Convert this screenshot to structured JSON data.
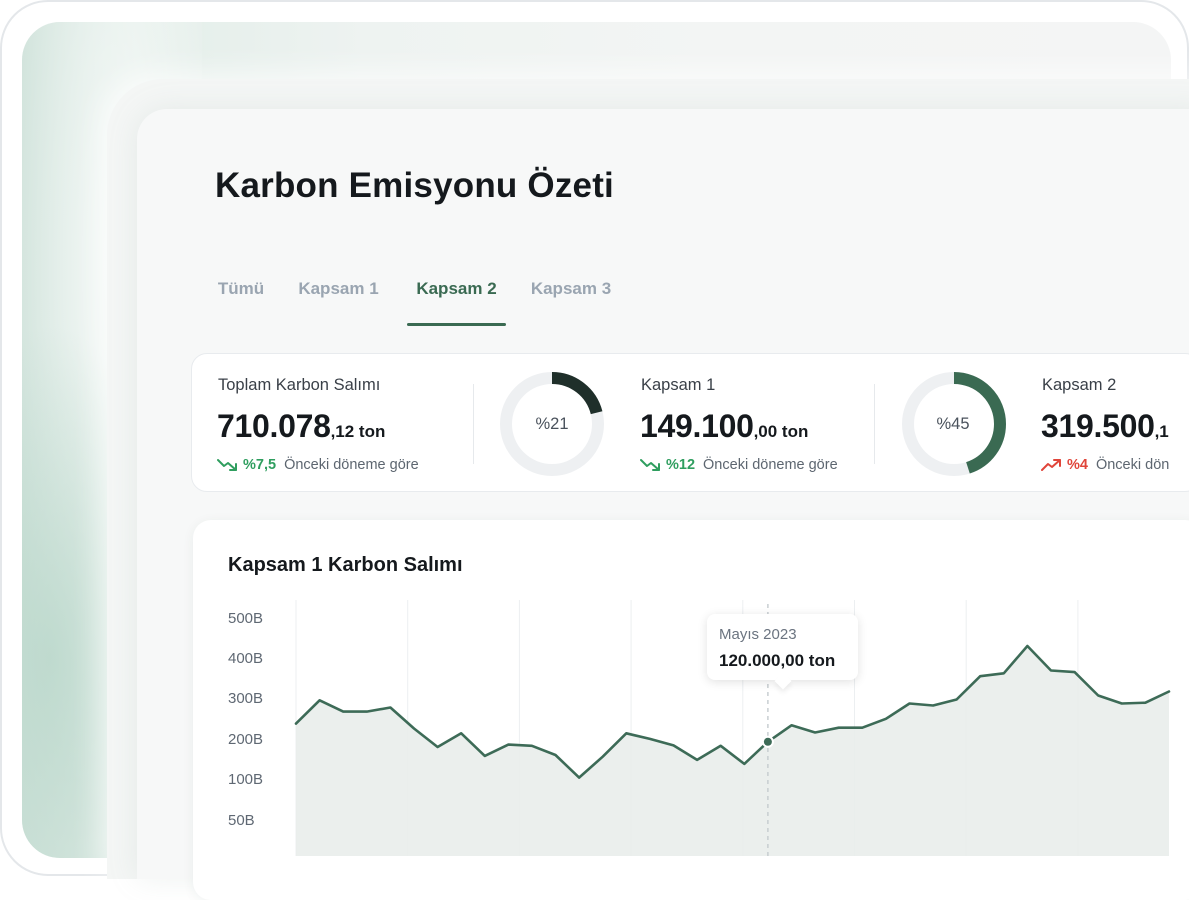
{
  "page": {
    "title": "Karbon Emisyonu Özeti"
  },
  "tabs": [
    {
      "label": "Tümü",
      "active": false
    },
    {
      "label": "Kapsam 1",
      "active": false
    },
    {
      "label": "Kapsam 2",
      "active": true
    },
    {
      "label": "Kapsam 3",
      "active": false
    }
  ],
  "stats": {
    "total": {
      "label": "Toplam Karbon Salımı",
      "value": "710.078",
      "value_unit": ",12 ton",
      "trend_direction": "down",
      "trend_percent": "%7,5",
      "trend_note": "Önceki döneme göre"
    },
    "scope1": {
      "donut_label": "%21",
      "donut_fraction": 0.21,
      "label": "Kapsam 1",
      "value": "149.100",
      "value_unit": ",00 ton",
      "trend_direction": "down",
      "trend_percent": "%12",
      "trend_note": "Önceki döneme göre"
    },
    "scope2": {
      "donut_label": "%45",
      "donut_fraction": 0.45,
      "label": "Kapsam 2",
      "value": "319.500",
      "value_unit": ",1",
      "trend_direction": "up",
      "trend_percent": "%4",
      "trend_note": "Önceki dön"
    }
  },
  "colors": {
    "accent": "#3a6a52",
    "donut_dark": "#1f2f2a",
    "donut_track": "#eef0f2",
    "trend_good": "#2f9e5f",
    "trend_bad": "#e0453a",
    "line": "#3d6b57",
    "area": "#e9edeb"
  },
  "chart_title": "Kapsam 1 Karbon Salımı",
  "tooltip": {
    "date": "Mayıs 2023",
    "value": "120.000,00 ton"
  },
  "chart_data": {
    "type": "area",
    "title": "Kapsam 1 Karbon Salımı",
    "xlabel": "",
    "ylabel": "",
    "yticks": [
      "500B",
      "400B",
      "300B",
      "200B",
      "100B",
      "50B"
    ],
    "ylim": [
      0,
      500
    ],
    "grid": "vertical",
    "series": [
      {
        "values": [
          240,
          298,
          270,
          270,
          280,
          228,
          182,
          216,
          160,
          188,
          185,
          162,
          106,
          158,
          216,
          202,
          186,
          150,
          185,
          140,
          195,
          236,
          218,
          230,
          230,
          252,
          290,
          285,
          300,
          358,
          365,
          433,
          372,
          368,
          310,
          290,
          292,
          320
        ]
      }
    ],
    "highlight": {
      "index": 20,
      "label": "Mayıs 2023",
      "value_text": "120.000,00 ton"
    }
  }
}
